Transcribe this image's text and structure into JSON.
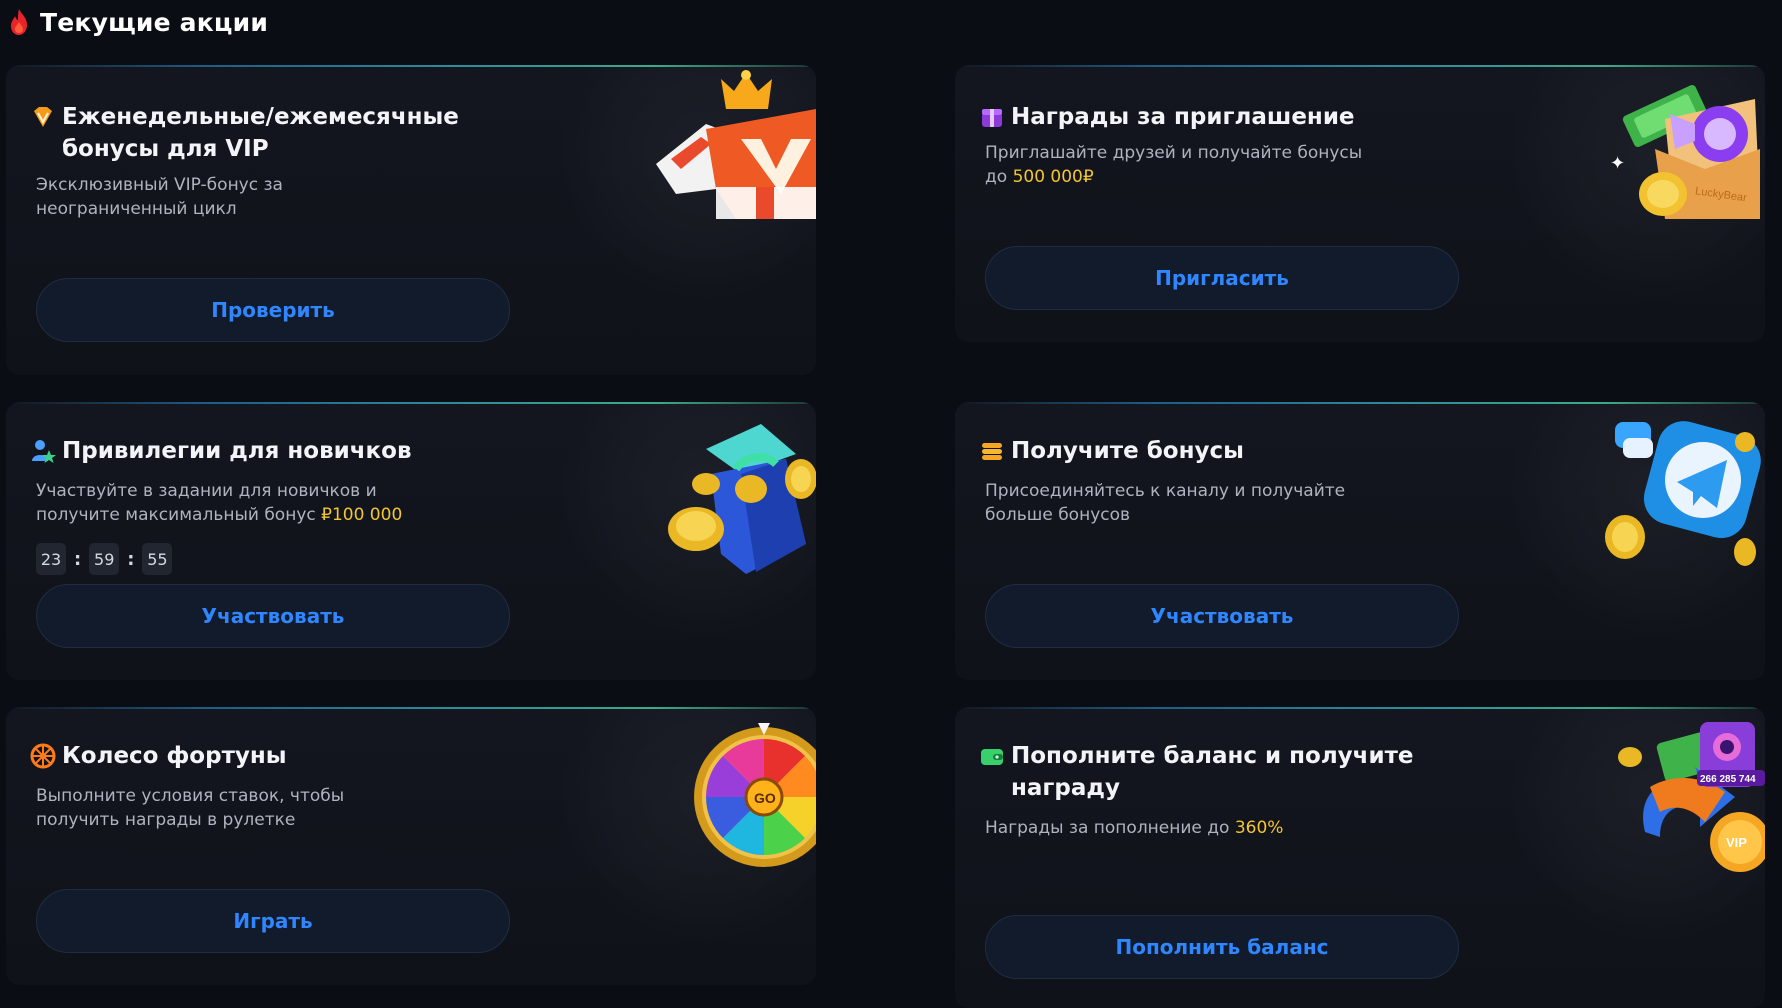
{
  "section": {
    "title": "Текущие акции",
    "icon": "flame-icon"
  },
  "cards": {
    "vip": {
      "title": "Еженедельные/ежемесячные бонусы для VIP",
      "title_line1": "Еженедельные/ежемесячные",
      "title_line2": "бонусы для VIP",
      "desc_line1": "Эксклюзивный VIP-бонус за",
      "desc_line2": "неограниченный цикл",
      "button": "Проверить",
      "icon": "vip-diamond-icon"
    },
    "invite": {
      "title": "Награды за приглашение",
      "desc_line1": "Приглашайте друзей и получайте бонусы",
      "desc_prefix": "до ",
      "desc_highlight": "500 000₽",
      "button": "Пригласить",
      "icon": "gift-box-icon",
      "art_label": "LuckyBear"
    },
    "newbie": {
      "title": "Привилегии для новичков",
      "desc_line1": "Участвуйте в задании для новичков и",
      "desc_prefix": "получите максимальный бонус ",
      "desc_highlight": "₽100 000",
      "timer": {
        "hours": "23",
        "minutes": "59",
        "seconds": "55",
        "separator": ":"
      },
      "button": "Участвовать",
      "icon": "user-star-icon"
    },
    "telegram": {
      "title": "Получите бонусы",
      "desc_line1": "Присоединяйтесь к каналу и получайте",
      "desc_line2": "больше бонусов",
      "button": "Участвовать",
      "icon": "coins-stack-icon"
    },
    "wheel": {
      "title": "Колесо фортуны",
      "desc_line1": "Выполните условия ставок, чтобы",
      "desc_line2": "получить награды в рулетке",
      "button": "Играть",
      "icon": "wheel-icon",
      "art_label": "GO"
    },
    "deposit": {
      "title_line1": "Пополните баланс и получите",
      "title_line2": "награду",
      "desc_prefix": "Награды за пополнение до ",
      "desc_highlight": "360%",
      "button": "Пополнить баланс",
      "icon": "wallet-icon",
      "art_label": "266 285 744",
      "art_badge": "VIP"
    }
  },
  "colors": {
    "accent": "#2f86ff",
    "highlight": "#f3c531",
    "background": "#0b0d14",
    "card": "#13161f"
  }
}
